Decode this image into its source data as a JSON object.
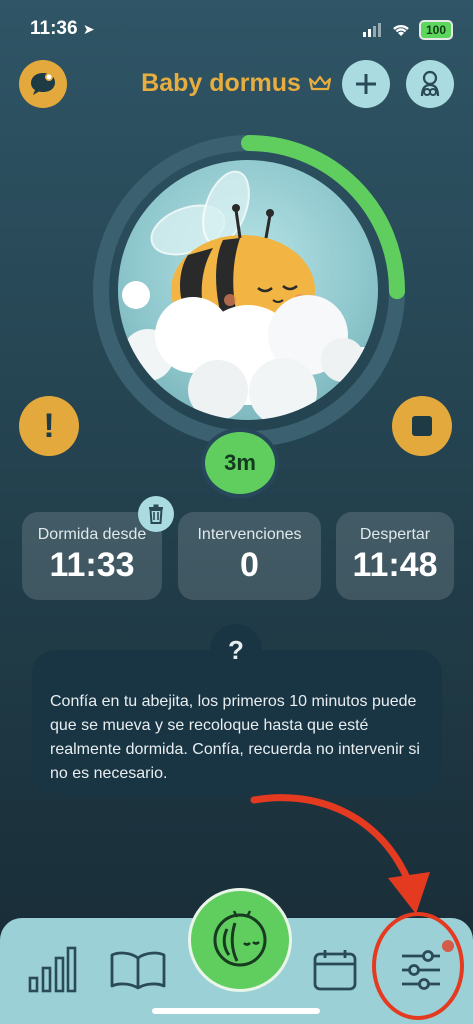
{
  "status": {
    "time": "11:36",
    "battery": "100"
  },
  "header": {
    "title": "Baby dormus"
  },
  "timer": {
    "elapsed": "3m",
    "progress_fraction": 0.25
  },
  "stats": [
    {
      "label": "Dormida desde",
      "value": "11:33"
    },
    {
      "label": "Intervenciones",
      "value": "0"
    },
    {
      "label": "Despertar",
      "value": "11:48"
    }
  ],
  "info": {
    "badge": "?",
    "text": "Confía en tu abejita, los primeros 10 minutos puede que se mueva y se recoloque hasta que esté realmente dormida. Confía, recuerda no intervenir si no es necesario."
  },
  "alert": {
    "symbol": "!"
  },
  "icons": {
    "chat": "chat-bubble-icon",
    "crown": "crown-icon",
    "plus": "plus-icon",
    "profile": "baby-profile-icon",
    "alert": "exclamation-icon",
    "stop": "stop-icon",
    "trash": "trash-icon",
    "stats": "bar-chart-icon",
    "book": "book-icon",
    "home": "sleeping-bee-icon",
    "calendar": "calendar-icon",
    "settings": "sliders-icon"
  },
  "colors": {
    "accent_yellow": "#e3a93d",
    "accent_green": "#5fce5f",
    "light_teal": "#a9dbe0",
    "annotation_red": "#e43a20"
  }
}
